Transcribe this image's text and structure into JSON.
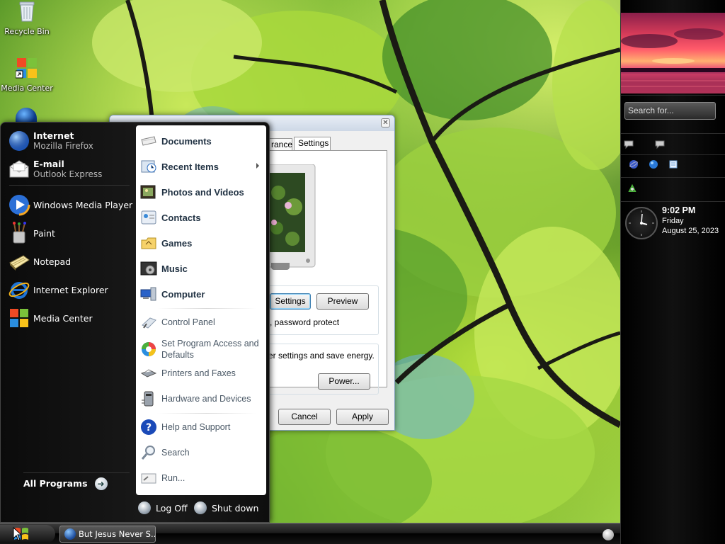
{
  "desktop": {
    "icons": [
      {
        "label": "Recycle Bin",
        "icon": "recycle-bin-icon"
      },
      {
        "label": "Media Center",
        "icon": "media-center-icon"
      }
    ]
  },
  "dialog": {
    "tabs": [
      "rance",
      "Settings"
    ],
    "buttons": {
      "settings": "Settings",
      "preview": "Preview",
      "power": "Power...",
      "cancel": "Cancel",
      "apply": "Apply"
    },
    "texts": {
      "password": ", password protect",
      "energy": "er settings and save energy."
    }
  },
  "start_menu": {
    "pinned": [
      {
        "title": "Internet",
        "subtitle": "Mozilla Firefox",
        "icon": "firefox-icon"
      },
      {
        "title": "E-mail",
        "subtitle": "Outlook Express",
        "icon": "outlook-express-icon"
      }
    ],
    "recent": [
      {
        "title": "Windows Media Player",
        "icon": "windows-media-player-icon"
      },
      {
        "title": "Paint",
        "icon": "paint-icon"
      },
      {
        "title": "Notepad",
        "icon": "notepad-icon"
      },
      {
        "title": "Internet Explorer",
        "icon": "internet-explorer-icon"
      },
      {
        "title": "Media Center",
        "icon": "media-center-icon"
      }
    ],
    "all_programs": "All Programs",
    "places_primary": [
      {
        "label": "Documents",
        "icon": "documents-icon"
      },
      {
        "label": "Recent Items",
        "icon": "recent-items-icon"
      },
      {
        "label": "Photos and Videos",
        "icon": "photos-videos-icon"
      },
      {
        "label": "Contacts",
        "icon": "contacts-icon"
      },
      {
        "label": "Games",
        "icon": "games-icon"
      },
      {
        "label": "Music",
        "icon": "music-icon"
      },
      {
        "label": "Computer",
        "icon": "computer-icon"
      }
    ],
    "places_secondary": [
      {
        "label": "Control Panel",
        "icon": "control-panel-icon"
      },
      {
        "label": "Set Program Access and Defaults",
        "icon": "program-access-icon"
      },
      {
        "label": "Printers and Faxes",
        "icon": "printer-icon"
      },
      {
        "label": "Hardware and Devices",
        "icon": "hardware-icon"
      }
    ],
    "places_help": [
      {
        "label": "Help and Support",
        "icon": "help-icon"
      },
      {
        "label": "Search",
        "icon": "search-icon"
      },
      {
        "label": "Run...",
        "icon": "run-icon"
      }
    ],
    "log_off": "Log Off",
    "shut_down": "Shut down"
  },
  "taskbar": {
    "task_label": "But Jesus Never S..."
  },
  "sidebar": {
    "search_placeholder": "Search for...",
    "clock": {
      "time": "9:02 PM",
      "day": "Friday",
      "date": "August 25, 2023"
    }
  },
  "colors": {
    "accent": "#1d6fd6",
    "menu_bg": "#111111"
  }
}
